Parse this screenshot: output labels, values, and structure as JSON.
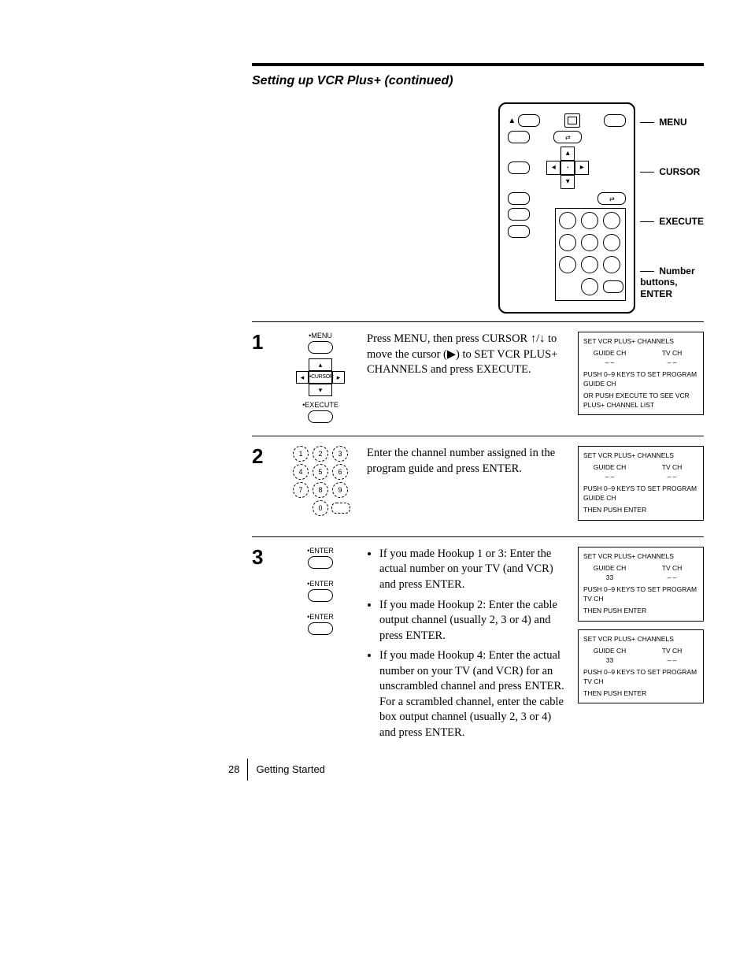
{
  "title": "Setting up VCR Plus+ (continued)",
  "remote_callouts": {
    "menu": "MENU",
    "cursor": "CURSOR",
    "execute": "EXECUTE",
    "numbers": "Number buttons, ENTER"
  },
  "steps": [
    {
      "num": "1",
      "mini": {
        "top_label": "•MENU",
        "mid_label": "•CURSOR",
        "bottom_label": "•EXECUTE"
      },
      "text": "Press MENU, then press CURSOR ↑/↓ to move the cursor (▶) to SET VCR PLUS+ CHANNELS and press EXECUTE.",
      "screens": [
        {
          "header": "SET VCR PLUS+ CHANNELS",
          "col1_label": "GUIDE  CH",
          "col1_val": "– –",
          "col2_label": "TV  CH",
          "col2_val": "– –",
          "msg1": "PUSH 0–9 KEYS TO SET PROGRAM GUIDE CH",
          "msg2": "OR PUSH EXECUTE TO SEE VCR PLUS+ CHANNEL LIST"
        }
      ]
    },
    {
      "num": "2",
      "mini": {
        "keypad": [
          "1",
          "2",
          "3",
          "4",
          "5",
          "6",
          "7",
          "8",
          "9",
          "0"
        ]
      },
      "text": "Enter the channel number assigned in the program guide and press ENTER.",
      "screens": [
        {
          "header": "SET VCR PLUS+ CHANNELS",
          "col1_label": "GUIDE  CH",
          "col1_val": "– –",
          "col2_label": "TV  CH",
          "col2_val": "– –",
          "msg1": "PUSH 0–9 KEYS TO SET PROGRAM GUIDE CH",
          "msg2": "THEN PUSH ENTER"
        }
      ]
    },
    {
      "num": "3",
      "mini": {
        "enter_labels": [
          "•ENTER",
          "•ENTER",
          "•ENTER"
        ]
      },
      "bullets": [
        "If you made Hookup 1 or 3: Enter the actual number on your TV (and VCR) and press ENTER.",
        "If you made Hookup 2: Enter the cable output channel (usually 2, 3 or 4) and press ENTER.",
        "If you made Hookup 4: Enter the actual number on your TV (and VCR) for an unscrambled channel and press ENTER. For a scrambled channel, enter the cable box output channel (usually 2, 3 or 4) and press ENTER."
      ],
      "screens": [
        {
          "header": "SET VCR PLUS+ CHANNELS",
          "col1_label": "GUIDE  CH",
          "col1_val": "33",
          "col2_label": "TV  CH",
          "col2_val": "– –",
          "msg1": "PUSH 0–9 KEYS TO SET PROGRAM TV CH",
          "msg2": "THEN PUSH ENTER"
        },
        {
          "header": "SET VCR PLUS+ CHANNELS",
          "col1_label": "GUIDE  CH",
          "col1_val": "33",
          "col2_label": "TV  CH",
          "col2_val": "– –",
          "msg1": "PUSH 0–9 KEYS TO SET PROGRAM TV CH",
          "msg2": "THEN PUSH ENTER"
        }
      ]
    }
  ],
  "footer": {
    "page": "28",
    "section": "Getting Started"
  }
}
